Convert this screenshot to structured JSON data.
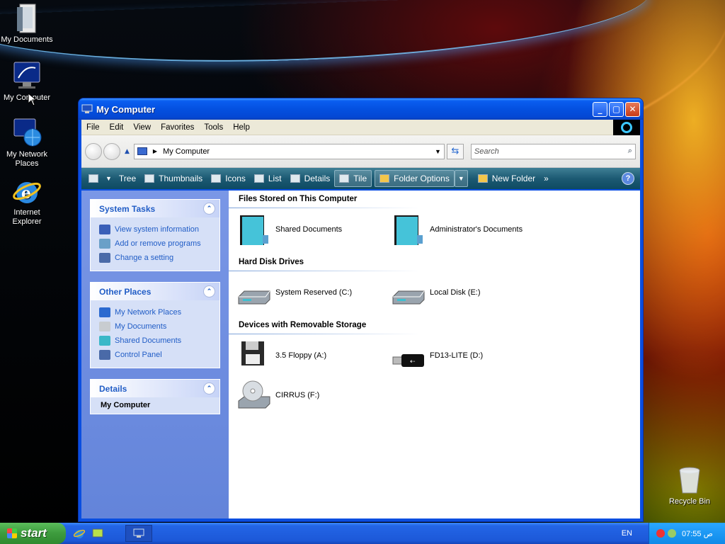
{
  "desktop": {
    "icons": [
      {
        "label": "My Documents"
      },
      {
        "label": "My Computer"
      },
      {
        "label": "My Network Places"
      },
      {
        "label": "Internet Explorer"
      },
      {
        "label": "Recycle Bin"
      }
    ]
  },
  "window": {
    "title": "My Computer",
    "menu": [
      "File",
      "Edit",
      "View",
      "Favorites",
      "Tools",
      "Help"
    ],
    "address": {
      "value": "My Computer"
    },
    "search": {
      "placeholder": "Search"
    },
    "toolbar": {
      "tree": "Tree",
      "thumbnails": "Thumbnails",
      "icons": "Icons",
      "list": "List",
      "details": "Details",
      "tile": "Tile",
      "folder_options": "Folder Options",
      "new_folder": "New Folder",
      "more": "»",
      "help": "?"
    },
    "left": {
      "system_tasks": {
        "title": "System Tasks",
        "items": [
          "View system information",
          "Add or remove programs",
          "Change a setting"
        ]
      },
      "other_places": {
        "title": "Other Places",
        "items": [
          "My Network Places",
          "My Documents",
          "Shared Documents",
          "Control Panel"
        ]
      },
      "details": {
        "title": "Details",
        "value": "My Computer"
      }
    },
    "groups": [
      {
        "title": "Files Stored on This Computer",
        "items": [
          "Shared Documents",
          "Administrator's Documents"
        ]
      },
      {
        "title": "Hard Disk Drives",
        "items": [
          "System Reserved (C:)",
          "Local Disk (E:)"
        ]
      },
      {
        "title": "Devices with Removable Storage",
        "items": [
          "3.5 Floppy (A:)",
          "FD13-LITE (D:)",
          "CIRRUS (F:)"
        ]
      }
    ]
  },
  "taskbar": {
    "start": "start",
    "language": "EN",
    "clock": "07:55 ص"
  },
  "colors": {
    "window_blue": "#0a4ee0",
    "toolbar_teal": "#1c5a73",
    "link_blue": "#215dc6",
    "start_green": "#3d9b3d"
  }
}
